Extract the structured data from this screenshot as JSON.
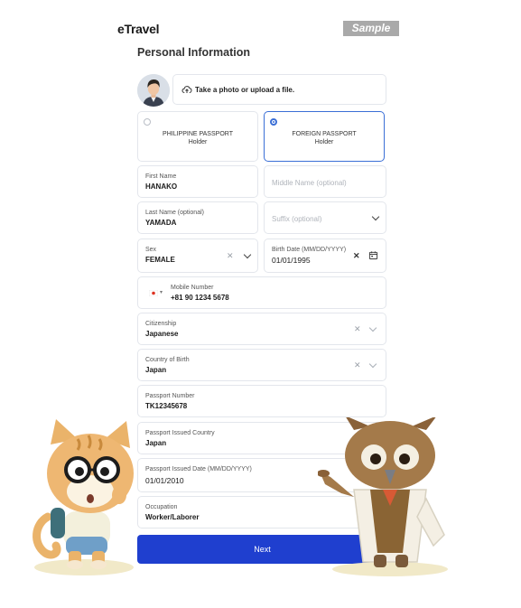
{
  "header": {
    "logo": "eTravel",
    "badge": "Sample"
  },
  "page_title": "Personal Information",
  "upload": {
    "label": "Take a photo or upload a file."
  },
  "passport_types": [
    {
      "line1": "PHILIPPINE PASSPORT",
      "line2": "Holder",
      "selected": false
    },
    {
      "line1": "FOREIGN PASSPORT",
      "line2": "Holder",
      "selected": true
    }
  ],
  "fields": {
    "first_name": {
      "label": "First Name",
      "value": "HANAKO"
    },
    "middle_name": {
      "placeholder": "Middle Name (optional)"
    },
    "last_name": {
      "label": "Last Name (optional)",
      "value": "YAMADA"
    },
    "suffix": {
      "placeholder": "Suffix (optional)"
    },
    "sex": {
      "label": "Sex",
      "value": "FEMALE"
    },
    "birth_date": {
      "label": "Birth Date (MM/DD/YYYY)",
      "value": "01/01/1995"
    },
    "mobile": {
      "label": "Mobile Number",
      "value": "+81 90 1234 5678"
    },
    "citizenship": {
      "label": "Citizenship",
      "value": "Japanese"
    },
    "country_of_birth": {
      "label": "Country of Birth",
      "value": "Japan"
    },
    "passport_number": {
      "label": "Passport Number",
      "value": "TK12345678"
    },
    "passport_issued_country": {
      "label": "Passport Issued Country",
      "value": "Japan"
    },
    "passport_issued_date": {
      "label": "Passport Issued Date (MM/DD/YYYY)",
      "value": "01/01/2010"
    },
    "occupation": {
      "label": "Occupation",
      "value": "Worker/Laborer"
    }
  },
  "next_button": {
    "label": "Next"
  },
  "colors": {
    "primary": "#1f3fcf",
    "selected_border": "#3b6fd6",
    "brand_red": "#e4342b"
  },
  "icons": [
    "avatar",
    "cloud-upload-icon",
    "calendar-icon",
    "japan-flag-icon",
    "chevron-down-icon",
    "clear-icon",
    "cat-mascot",
    "owl-mascot"
  ]
}
